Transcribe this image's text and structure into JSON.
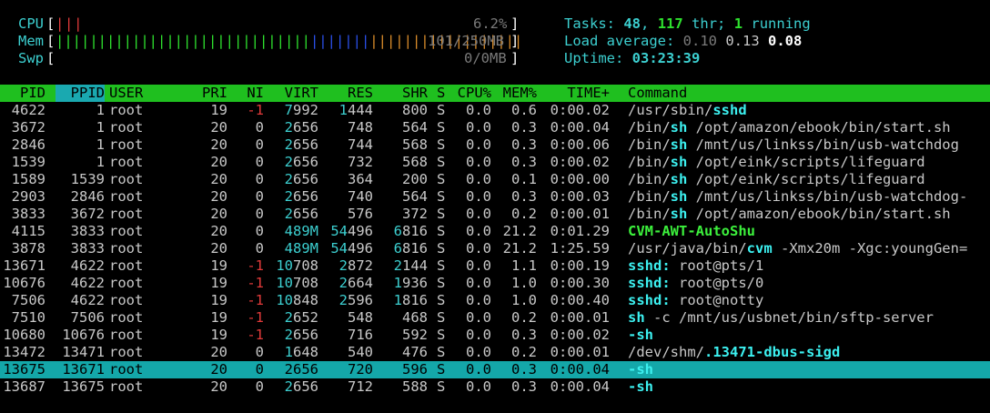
{
  "meters": {
    "cpu": {
      "label": "CPU",
      "value": "6.2%",
      "bars_red": "|||",
      "bars_green": ""
    },
    "mem": {
      "label": "Mem",
      "value": "101/250MB",
      "bars_green": "||||||||||||||||||||||||||||||",
      "bars_blue": "|||||||",
      "bars_orange": "||||||||||||||||||"
    },
    "swp": {
      "label": "Swp",
      "value": "0/0MB"
    }
  },
  "summary": {
    "tasks_label": "Tasks:",
    "tasks": "48",
    "thr": "117",
    "thr_label": "thr;",
    "running": "1",
    "running_label": "running",
    "load_label": "Load average:",
    "load1": "0.10",
    "load5": "0.13",
    "load15": "0.08",
    "uptime_label": "Uptime:",
    "uptime": "03:23:39"
  },
  "columns": [
    "PID",
    "PPID",
    "USER",
    "PRI",
    "NI",
    "VIRT",
    "RES",
    "SHR",
    "S",
    "CPU%",
    "MEM%",
    "TIME+",
    "Command"
  ],
  "sorted_column": "PPID",
  "processes": [
    {
      "pid": "4622",
      "ppid": "1",
      "user": "root",
      "pri": "19",
      "ni": "-1",
      "virt": "7992",
      "res": "1444",
      "shr": "800",
      "s": "S",
      "cpu": "0.0",
      "mem": "0.6",
      "time": "0:00.02",
      "cmd_pre": "/usr/sbin/",
      "cmd_hi": "sshd",
      "cmd_post": "",
      "hi": "cyan"
    },
    {
      "pid": "3672",
      "ppid": "1",
      "user": "root",
      "pri": "20",
      "ni": "0",
      "virt": "2656",
      "res": "748",
      "shr": "564",
      "s": "S",
      "cpu": "0.0",
      "mem": "0.3",
      "time": "0:00.04",
      "cmd_pre": "/bin/",
      "cmd_hi": "sh",
      "cmd_post": " /opt/amazon/ebook/bin/start.sh",
      "hi": "cyan"
    },
    {
      "pid": "2846",
      "ppid": "1",
      "user": "root",
      "pri": "20",
      "ni": "0",
      "virt": "2656",
      "res": "744",
      "shr": "568",
      "s": "S",
      "cpu": "0.0",
      "mem": "0.3",
      "time": "0:00.06",
      "cmd_pre": "/bin/",
      "cmd_hi": "sh",
      "cmd_post": " /mnt/us/linkss/bin/usb-watchdog",
      "hi": "cyan"
    },
    {
      "pid": "1539",
      "ppid": "1",
      "user": "root",
      "pri": "20",
      "ni": "0",
      "virt": "2656",
      "res": "732",
      "shr": "568",
      "s": "S",
      "cpu": "0.0",
      "mem": "0.3",
      "time": "0:00.02",
      "cmd_pre": "/bin/",
      "cmd_hi": "sh",
      "cmd_post": " /opt/eink/scripts/lifeguard",
      "hi": "cyan"
    },
    {
      "pid": "1589",
      "ppid": "1539",
      "user": "root",
      "pri": "20",
      "ni": "0",
      "virt": "2656",
      "res": "364",
      "shr": "200",
      "s": "S",
      "cpu": "0.0",
      "mem": "0.1",
      "time": "0:00.00",
      "cmd_pre": "/bin/",
      "cmd_hi": "sh",
      "cmd_post": " /opt/eink/scripts/lifeguard",
      "hi": "cyan"
    },
    {
      "pid": "2903",
      "ppid": "2846",
      "user": "root",
      "pri": "20",
      "ni": "0",
      "virt": "2656",
      "res": "740",
      "shr": "564",
      "s": "S",
      "cpu": "0.0",
      "mem": "0.3",
      "time": "0:00.03",
      "cmd_pre": "/bin/",
      "cmd_hi": "sh",
      "cmd_post": " /mnt/us/linkss/bin/usb-watchdog-",
      "hi": "cyan"
    },
    {
      "pid": "3833",
      "ppid": "3672",
      "user": "root",
      "pri": "20",
      "ni": "0",
      "virt": "2656",
      "res": "576",
      "shr": "372",
      "s": "S",
      "cpu": "0.0",
      "mem": "0.2",
      "time": "0:00.01",
      "cmd_pre": "/bin/",
      "cmd_hi": "sh",
      "cmd_post": " /opt/amazon/ebook/bin/start.sh",
      "hi": "cyan"
    },
    {
      "pid": "4115",
      "ppid": "3833",
      "user": "root",
      "pri": "20",
      "ni": "0",
      "virt": "489M",
      "res": "54496",
      "shr": "6816",
      "s": "S",
      "cpu": "0.0",
      "mem": "21.2",
      "time": "0:01.29",
      "cmd_pre": "",
      "cmd_hi": "CVM-AWT-AutoShu",
      "cmd_post": "",
      "hi": "green"
    },
    {
      "pid": "3878",
      "ppid": "3833",
      "user": "root",
      "pri": "20",
      "ni": "0",
      "virt": "489M",
      "res": "54496",
      "shr": "6816",
      "s": "S",
      "cpu": "0.0",
      "mem": "21.2",
      "time": "1:25.59",
      "cmd_pre": "/usr/java/bin/",
      "cmd_hi": "cvm",
      "cmd_post": " -Xmx20m -Xgc:youngGen=",
      "hi": "cyan"
    },
    {
      "pid": "13671",
      "ppid": "4622",
      "user": "root",
      "pri": "19",
      "ni": "-1",
      "virt": "10708",
      "res": "2872",
      "shr": "2144",
      "s": "S",
      "cpu": "0.0",
      "mem": "1.1",
      "time": "0:00.19",
      "cmd_pre": "",
      "cmd_hi": "sshd:",
      "cmd_post": " root@pts/1",
      "hi": "cyan"
    },
    {
      "pid": "10676",
      "ppid": "4622",
      "user": "root",
      "pri": "19",
      "ni": "-1",
      "virt": "10708",
      "res": "2664",
      "shr": "1936",
      "s": "S",
      "cpu": "0.0",
      "mem": "1.0",
      "time": "0:00.30",
      "cmd_pre": "",
      "cmd_hi": "sshd:",
      "cmd_post": " root@pts/0",
      "hi": "cyan"
    },
    {
      "pid": "7506",
      "ppid": "4622",
      "user": "root",
      "pri": "19",
      "ni": "-1",
      "virt": "10848",
      "res": "2596",
      "shr": "1816",
      "s": "S",
      "cpu": "0.0",
      "mem": "1.0",
      "time": "0:00.40",
      "cmd_pre": "",
      "cmd_hi": "sshd:",
      "cmd_post": " root@notty",
      "hi": "cyan"
    },
    {
      "pid": "7510",
      "ppid": "7506",
      "user": "root",
      "pri": "19",
      "ni": "-1",
      "virt": "2652",
      "res": "548",
      "shr": "468",
      "s": "S",
      "cpu": "0.0",
      "mem": "0.2",
      "time": "0:00.01",
      "cmd_pre": "",
      "cmd_hi": "sh",
      "cmd_post": " -c /mnt/us/usbnet/bin/sftp-server",
      "hi": "cyan"
    },
    {
      "pid": "10680",
      "ppid": "10676",
      "user": "root",
      "pri": "19",
      "ni": "-1",
      "virt": "2656",
      "res": "716",
      "shr": "592",
      "s": "S",
      "cpu": "0.0",
      "mem": "0.3",
      "time": "0:00.02",
      "cmd_pre": "",
      "cmd_hi": "-sh",
      "cmd_post": "",
      "hi": "cyan"
    },
    {
      "pid": "13472",
      "ppid": "13471",
      "user": "root",
      "pri": "20",
      "ni": "0",
      "virt": "1648",
      "res": "540",
      "shr": "476",
      "s": "S",
      "cpu": "0.0",
      "mem": "0.2",
      "time": "0:00.01",
      "cmd_pre": "/dev/shm/",
      "cmd_hi": ".13471-dbus-sigd",
      "cmd_post": "",
      "hi": "cyan"
    },
    {
      "pid": "13675",
      "ppid": "13671",
      "user": "root",
      "pri": "20",
      "ni": "0",
      "virt": "2656",
      "res": "720",
      "shr": "596",
      "s": "S",
      "cpu": "0.0",
      "mem": "0.3",
      "time": "0:00.04",
      "cmd_pre": "",
      "cmd_hi": "-sh",
      "cmd_post": "",
      "hi": "cyan",
      "selected": true
    },
    {
      "pid": "13687",
      "ppid": "13675",
      "user": "root",
      "pri": "20",
      "ni": "0",
      "virt": "2656",
      "res": "712",
      "shr": "588",
      "s": "S",
      "cpu": "0.0",
      "mem": "0.3",
      "time": "0:00.04",
      "cmd_pre": "",
      "cmd_hi": "-sh",
      "cmd_post": "",
      "hi": "cyan"
    }
  ]
}
